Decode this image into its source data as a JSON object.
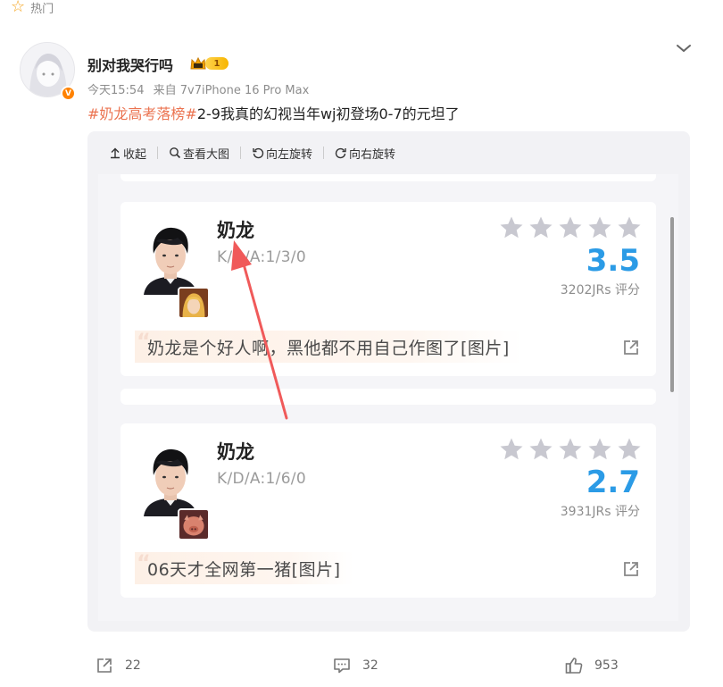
{
  "feed": {
    "section_label": "热门"
  },
  "post": {
    "author": "别对我哭行吗",
    "vip_level": "1",
    "time": "今天15:54",
    "source": "来自 7v7iPhone 16 Pro Max",
    "hashtag": "#奶龙高考落榜#",
    "text": "2-9我真的幻视当年wj初登场0-7的元坦了",
    "accent_color": "#eb7350"
  },
  "media_toolbar": {
    "collapse": "收起",
    "view_large": "查看大图",
    "rotate_left": "向左旋转",
    "rotate_right": "向右旋转"
  },
  "cards": [
    {
      "player_name": "奶龙",
      "kda": "K/D/A:1/3/0",
      "score": "3.5",
      "ratings": "3202JRs 评分",
      "comment": "奶龙是个好人啊，黑他都不用自己作图了[图片]",
      "stars_filled": 0
    },
    {
      "player_name": "奶龙",
      "kda": "K/D/A:1/6/0",
      "score": "2.7",
      "ratings": "3931JRs 评分",
      "comment": "06天才全网第一猪[图片]",
      "stars_filled": 0
    }
  ],
  "actions": {
    "forward_count": "22",
    "comment_count": "32",
    "like_count": "953"
  },
  "colors": {
    "score_blue": "#2b9be6",
    "star_grey": "#c8c8d0",
    "annotation_arrow": "#f05a5a",
    "weibo_orange": "#ff8200"
  },
  "icons": [
    "star-outline-icon",
    "chevron-down-icon",
    "verified-v-icon",
    "crown-icon",
    "collapse-icon",
    "magnifier-icon",
    "rotate-left-icon",
    "rotate-right-icon",
    "rating-star-icon",
    "share-out-icon",
    "forward-icon",
    "comment-icon",
    "like-icon"
  ]
}
